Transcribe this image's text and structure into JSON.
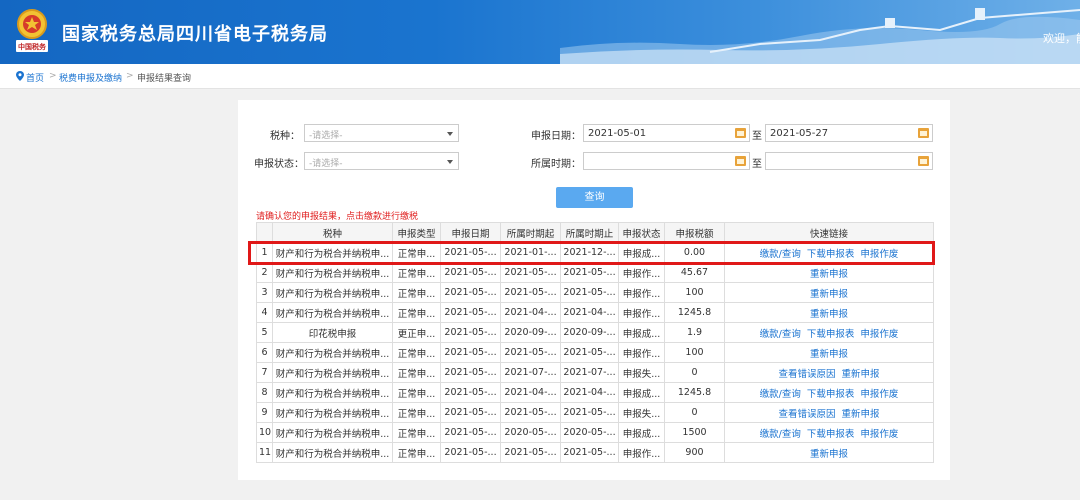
{
  "header": {
    "title": "国家税务总局四川省电子税务局",
    "emblem_text": "中国税务",
    "welcome": "欢迎，能"
  },
  "breadcrumb": {
    "home": "首页",
    "level1": "税费申报及缴纳",
    "current": "申报结果查询",
    "separator": ">"
  },
  "form": {
    "tax_type_label": "税种：",
    "tax_type_placeholder": "-请选择-",
    "status_label": "申报状态：",
    "status_placeholder": "-请选择-",
    "declare_date_label": "申报日期：",
    "declare_date_from": "2021-05-01",
    "range_to": "至",
    "declare_date_to": "2021-05-27",
    "period_label": "所属时期：",
    "period_from": "",
    "period_to": ""
  },
  "query_button": "查询",
  "tip": "请确认您的申报结果，点击缴款进行缴税",
  "table": {
    "headers": [
      "",
      "税种",
      "申报类型",
      "申报日期",
      "所属时期起",
      "所属时期止",
      "申报状态",
      "申报税额",
      "快速链接"
    ],
    "rows": [
      {
        "no": "1",
        "tax": "财产和行为税合并纳税申...",
        "type": "正常申...",
        "date": "2021-05-...",
        "start": "2021-01-...",
        "end": "2021-12-...",
        "status": "申报成...",
        "amount": "0.00",
        "links": [
          "缴款/查询",
          "下载申报表",
          "申报作废"
        ]
      },
      {
        "no": "2",
        "tax": "财产和行为税合并纳税申...",
        "type": "正常申...",
        "date": "2021-05-...",
        "start": "2021-05-...",
        "end": "2021-05-...",
        "status": "申报作...",
        "amount": "45.67",
        "links": [
          "重新申报"
        ]
      },
      {
        "no": "3",
        "tax": "财产和行为税合并纳税申...",
        "type": "正常申...",
        "date": "2021-05-...",
        "start": "2021-05-...",
        "end": "2021-05-...",
        "status": "申报作...",
        "amount": "100",
        "links": [
          "重新申报"
        ]
      },
      {
        "no": "4",
        "tax": "财产和行为税合并纳税申...",
        "type": "正常申...",
        "date": "2021-05-...",
        "start": "2021-04-...",
        "end": "2021-04-...",
        "status": "申报作...",
        "amount": "1245.8",
        "links": [
          "重新申报"
        ]
      },
      {
        "no": "5",
        "tax": "印花税申报",
        "type": "更正申...",
        "date": "2021-05-...",
        "start": "2020-09-...",
        "end": "2020-09-...",
        "status": "申报成...",
        "amount": "1.9",
        "links": [
          "缴款/查询",
          "下载申报表",
          "申报作废"
        ]
      },
      {
        "no": "6",
        "tax": "财产和行为税合并纳税申...",
        "type": "正常申...",
        "date": "2021-05-...",
        "start": "2021-05-...",
        "end": "2021-05-...",
        "status": "申报作...",
        "amount": "100",
        "links": [
          "重新申报"
        ]
      },
      {
        "no": "7",
        "tax": "财产和行为税合并纳税申...",
        "type": "正常申...",
        "date": "2021-05-...",
        "start": "2021-07-...",
        "end": "2021-07-...",
        "status": "申报失...",
        "amount": "0",
        "links": [
          "查看错误原因",
          "重新申报"
        ]
      },
      {
        "no": "8",
        "tax": "财产和行为税合并纳税申...",
        "type": "正常申...",
        "date": "2021-05-...",
        "start": "2021-04-...",
        "end": "2021-04-...",
        "status": "申报成...",
        "amount": "1245.8",
        "links": [
          "缴款/查询",
          "下载申报表",
          "申报作废"
        ]
      },
      {
        "no": "9",
        "tax": "财产和行为税合并纳税申...",
        "type": "正常申...",
        "date": "2021-05-...",
        "start": "2021-05-...",
        "end": "2021-05-...",
        "status": "申报失...",
        "amount": "0",
        "links": [
          "查看错误原因",
          "重新申报"
        ]
      },
      {
        "no": "10",
        "tax": "财产和行为税合并纳税申...",
        "type": "正常申...",
        "date": "2021-05-...",
        "start": "2020-05-...",
        "end": "2020-05-...",
        "status": "申报成...",
        "amount": "1500",
        "links": [
          "缴款/查询",
          "下载申报表",
          "申报作废"
        ]
      },
      {
        "no": "11",
        "tax": "财产和行为税合并纳税申...",
        "type": "正常申...",
        "date": "2021-05-...",
        "start": "2021-05-...",
        "end": "2021-05-...",
        "status": "申报作...",
        "amount": "900",
        "links": [
          "重新申报"
        ]
      }
    ]
  },
  "colors": {
    "header_blue": "#1467c2",
    "link_blue": "#1a73d0",
    "button_blue": "#5aa9f0",
    "tip_red": "#e02020",
    "highlight_red": "#e01818",
    "calendar_orange": "#e8a33a"
  },
  "icons": {
    "emblem": "tax-emblem-icon",
    "home": "location-pin-icon",
    "calendar": "calendar-icon",
    "dropdown": "chevron-down-icon"
  }
}
